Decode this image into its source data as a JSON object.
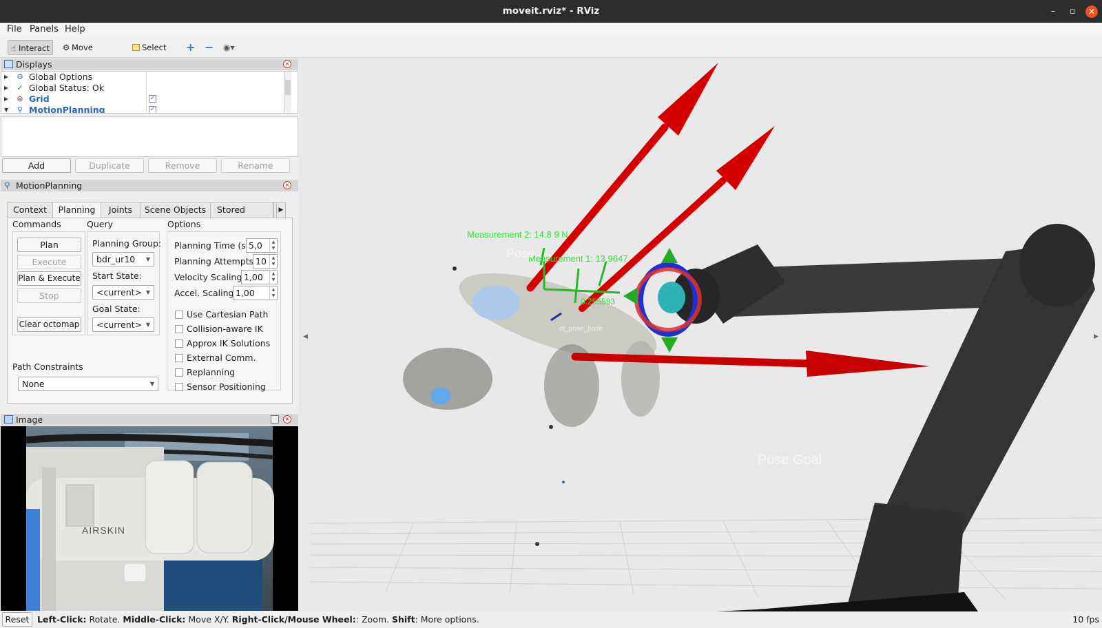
{
  "window": {
    "title": "moveit.rviz* - RViz",
    "close_label": "✕",
    "min_label": "–",
    "max_label": "▫"
  },
  "menu": {
    "file": "File",
    "panels": "Panels",
    "help": "Help"
  },
  "toolbar": {
    "interact": "Interact",
    "move_camera": "Move Camera",
    "select": "Select"
  },
  "displays": {
    "title": "Displays",
    "items": [
      {
        "label": "Global Options",
        "icon": "gear-icon"
      },
      {
        "label": "Global Status: Ok",
        "icon": "check-icon"
      },
      {
        "label": "Grid",
        "icon": "grid-icon",
        "checked": true
      },
      {
        "label": "MotionPlanning",
        "icon": "motion-planning-icon",
        "checked": true
      }
    ],
    "buttons": {
      "add": "Add",
      "duplicate": "Duplicate",
      "remove": "Remove",
      "rename": "Rename"
    }
  },
  "motion_planning": {
    "title": "MotionPlanning",
    "tabs": [
      "Context",
      "Planning",
      "Joints",
      "Scene Objects",
      "Stored Scene"
    ],
    "selected_tab": "Planning",
    "commands": {
      "title": "Commands",
      "plan": "Plan",
      "execute": "Execute",
      "plan_execute": "Plan & Execute",
      "stop": "Stop",
      "clear_octomap": "Clear octomap"
    },
    "query": {
      "title": "Query",
      "planning_group_label": "Planning Group:",
      "planning_group": "bdr_ur10",
      "start_state_label": "Start State:",
      "start_state": "<current>",
      "goal_state_label": "Goal State:",
      "goal_state": "<current>"
    },
    "options": {
      "title": "Options",
      "planning_time_label": "Planning Time (s):",
      "planning_time": "5,0",
      "planning_attempts_label": "Planning Attempts:",
      "planning_attempts": "10",
      "velocity_scaling_label": "Velocity Scaling:",
      "velocity_scaling": "1,00",
      "accel_scaling_label": "Accel. Scaling:",
      "accel_scaling": "1,00",
      "checkboxes": [
        "Use Cartesian Path",
        "Collision-aware IK",
        "Approx IK Solutions",
        "External Comm.",
        "Replanning",
        "Sensor Positioning"
      ]
    },
    "path_constraints": {
      "title": "Path Constraints",
      "value": "None"
    }
  },
  "image_panel": {
    "title": "Image",
    "logo_text": "AIRSKIN"
  },
  "viewport": {
    "measurement2": "Measurement  2:  14.8   9  N",
    "measurement1": "Measurement  1:  13.9647",
    "meas_value": "0.255593",
    "pose_label": "Pose",
    "target_label": "et_pose_base",
    "goal_pose": "Pose   Goal"
  },
  "status": {
    "reset": "Reset",
    "lc": "Left-Click:",
    "lc_t": " Rotate. ",
    "mc": "Middle-Click:",
    "mc_t": " Move X/Y. ",
    "rc": "Right-Click/Mouse Wheel:",
    "rc_t": ": Zoom. ",
    "sh": "Shift",
    "sh_t": ": More options.",
    "fps": "10 fps"
  },
  "colors": {
    "title_bg": "#2c2c2c",
    "measurement_text": "#2ee62e",
    "arrow_red": "#d40000",
    "close_orange": "#e95420"
  }
}
